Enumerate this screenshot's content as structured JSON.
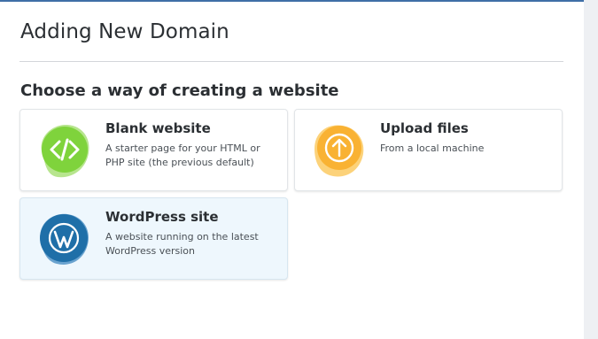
{
  "page": {
    "title": "Adding New Domain",
    "section_heading": "Choose a way of creating a website"
  },
  "colors": {
    "accent_line": "#3f6fa6",
    "blank_icon_green": "#7fd33c",
    "upload_icon_orange": "#f9b233",
    "wordpress_icon_blue": "#1f6fa8",
    "selected_card_bg": "#eef7fd"
  },
  "options": [
    {
      "id": "blank",
      "icon": "code-icon",
      "title": "Blank website",
      "description": "A starter page for your HTML or PHP site (the previous default)"
    },
    {
      "id": "upload",
      "icon": "upload-arrow-icon",
      "title": "Upload files",
      "description": "From a local machine"
    },
    {
      "id": "wordpress",
      "icon": "wordpress-icon",
      "title": "WordPress site",
      "description": "A website running on the latest WordPress version",
      "selected": true
    }
  ]
}
